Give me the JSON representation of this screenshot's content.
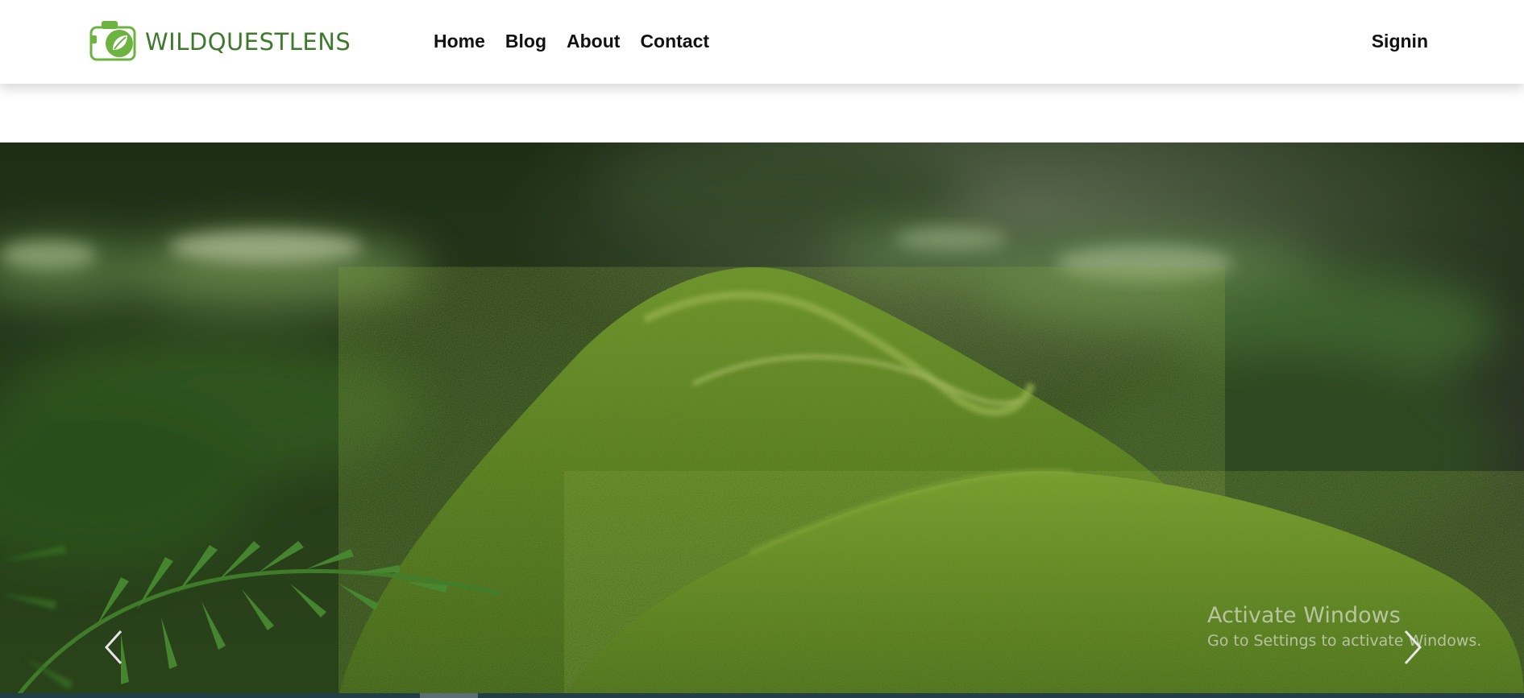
{
  "brand": {
    "name": "WILDQUESTLENS",
    "logo_icon": "camera-leaf-icon",
    "color": "#3d7a2c"
  },
  "nav": {
    "links": [
      {
        "label": "Home"
      },
      {
        "label": "Blog"
      },
      {
        "label": "About"
      },
      {
        "label": "Contact"
      }
    ],
    "signin_label": "Signin"
  },
  "carousel": {
    "image_subject": "moss-covered log in forest with ferns",
    "prev_icon": "chevron-left-icon",
    "next_icon": "chevron-right-icon"
  },
  "watermark": {
    "title": "Activate Windows",
    "subtitle": "Go to Settings to activate Windows."
  },
  "colors": {
    "accent_green": "#3d7a2c",
    "footer_dark": "#233e46"
  }
}
